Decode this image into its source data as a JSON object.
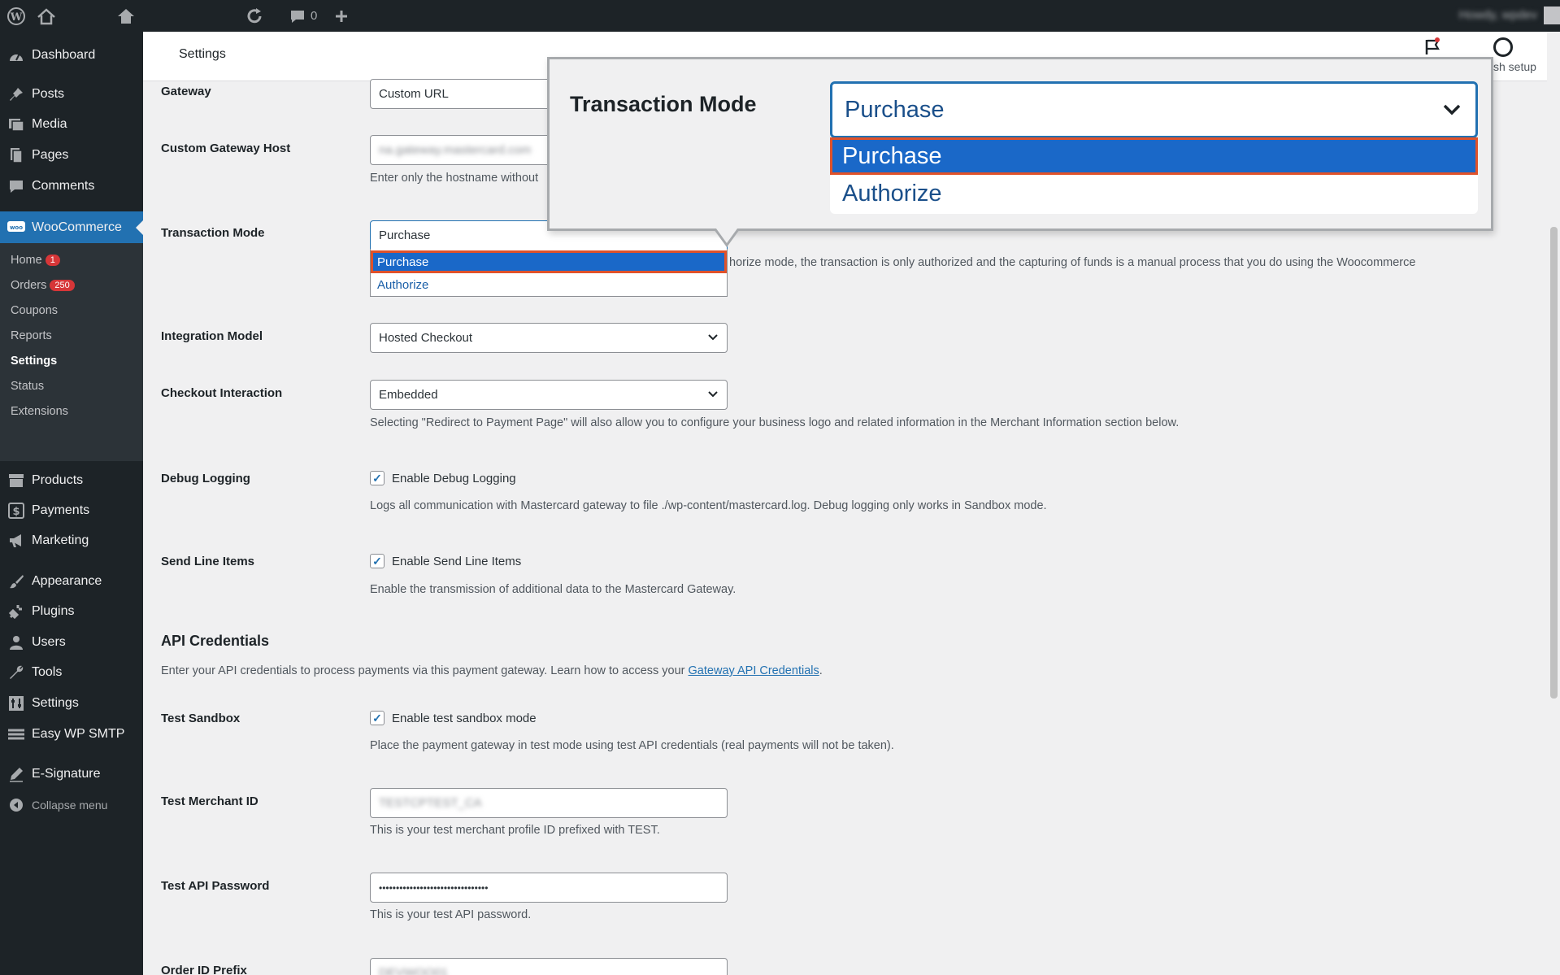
{
  "admin_bar": {
    "comments_count": "0",
    "howdy": "Howdy, wpdev"
  },
  "sidebar": {
    "items": [
      {
        "label": "Dashboard",
        "icon": "dashboard-icon"
      },
      {
        "label": "Posts",
        "icon": "pin-icon"
      },
      {
        "label": "Media",
        "icon": "media-icon"
      },
      {
        "label": "Pages",
        "icon": "page-icon"
      },
      {
        "label": "Comments",
        "icon": "comment-icon"
      },
      {
        "label": "WooCommerce",
        "icon": "woo-icon"
      },
      {
        "label": "Products",
        "icon": "archive-icon"
      },
      {
        "label": "Payments",
        "icon": "dollar-icon"
      },
      {
        "label": "Marketing",
        "icon": "megaphone-icon"
      },
      {
        "label": "Appearance",
        "icon": "brush-icon"
      },
      {
        "label": "Plugins",
        "icon": "plug-icon"
      },
      {
        "label": "Users",
        "icon": "user-icon"
      },
      {
        "label": "Tools",
        "icon": "wrench-icon"
      },
      {
        "label": "Settings",
        "icon": "settings-icon"
      },
      {
        "label": "Easy WP SMTP",
        "icon": "mail-icon"
      },
      {
        "label": "E-Signature",
        "icon": "pen-icon"
      },
      {
        "label": "Collapse menu",
        "icon": "collapse-icon"
      }
    ],
    "submenu": [
      {
        "label": "Home",
        "badge": "1"
      },
      {
        "label": "Orders",
        "badge": "250"
      },
      {
        "label": "Coupons"
      },
      {
        "label": "Reports"
      },
      {
        "label": "Settings"
      },
      {
        "label": "Status"
      },
      {
        "label": "Extensions"
      }
    ]
  },
  "header": {
    "title": "Settings",
    "finish_setup": "sh setup"
  },
  "form": {
    "gateway": {
      "label": "Gateway",
      "value": "Custom URL"
    },
    "custom_host": {
      "label": "Custom Gateway Host",
      "value": "na.gateway.mastercard.com",
      "desc": "Enter only the hostname without"
    },
    "transaction_mode": {
      "label": "Transaction Mode",
      "value": "Purchase",
      "options": [
        "Purchase",
        "Authorize"
      ],
      "desc": "horize mode, the transaction is only authorized and the capturing of funds is a manual process that you do using the Woocommerce"
    },
    "integration_model": {
      "label": "Integration Model",
      "value": "Hosted Checkout"
    },
    "checkout_interaction": {
      "label": "Checkout Interaction",
      "value": "Embedded",
      "desc": "Selecting \"Redirect to Payment Page\" will also allow you to configure your business logo and related information in the Merchant Information section below."
    },
    "debug_logging": {
      "label": "Debug Logging",
      "checkbox": "Enable Debug Logging",
      "desc": "Logs all communication with Mastercard gateway to file ./wp-content/mastercard.log. Debug logging only works in Sandbox mode."
    },
    "send_line_items": {
      "label": "Send Line Items",
      "checkbox": "Enable Send Line Items",
      "desc": "Enable the transmission of additional data to the Mastercard Gateway."
    },
    "api_credentials": {
      "title": "API Credentials",
      "desc_prefix": "Enter your API credentials to process payments via this payment gateway. Learn how to access your ",
      "link": "Gateway API Credentials",
      "desc_suffix": "."
    },
    "test_sandbox": {
      "label": "Test Sandbox",
      "checkbox": "Enable test sandbox mode",
      "desc": "Place the payment gateway in test mode using test API credentials (real payments will not be taken)."
    },
    "test_merchant_id": {
      "label": "Test Merchant ID",
      "value": "TESTCPTEST_CA",
      "desc": "This is your test merchant profile ID prefixed with TEST."
    },
    "test_api_password": {
      "label": "Test API Password",
      "value": "••••••••••••••••••••••••••••••••",
      "desc": "This is your test API password."
    },
    "order_id_prefix": {
      "label": "Order ID Prefix",
      "value": "DEVWOO01"
    }
  },
  "zoom": {
    "label": "Transaction Mode",
    "value": "Purchase",
    "options": [
      "Purchase",
      "Authorize"
    ]
  },
  "colors": {
    "accent": "#2271b1",
    "selected_bg": "#1a68c8",
    "highlight_border": "#e0522a",
    "admin_bg": "#1d2327"
  }
}
